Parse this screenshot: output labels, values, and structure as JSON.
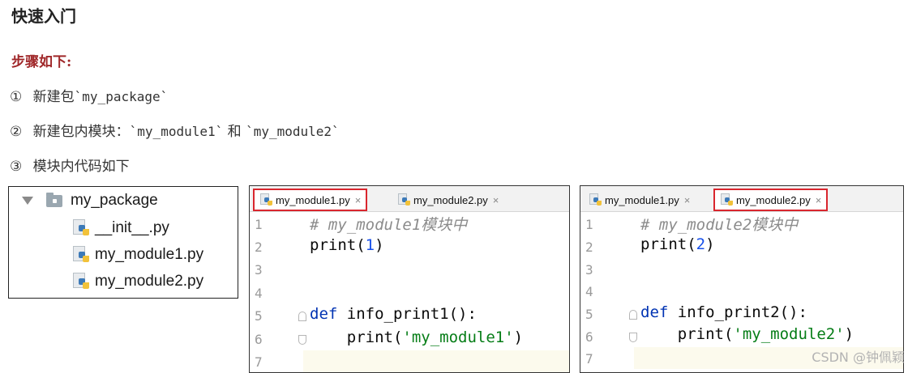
{
  "heading": "快速入门",
  "steps_label": "步骤如下:",
  "steps": [
    {
      "num": "①",
      "text": "新建包",
      "code": "`my_package`",
      "rest": ""
    },
    {
      "num": "②",
      "text": "新建包内模块：",
      "code": "`my_module1`",
      "mid": " 和 ",
      "code2": "`my_module2`"
    },
    {
      "num": "③",
      "text": "模块内代码如下"
    }
  ],
  "tree": {
    "folder": "my_package",
    "files": [
      "__init__.py",
      "my_module1.py",
      "my_module2.py"
    ]
  },
  "editor1": {
    "tabs": [
      "my_module1.py",
      "my_module2.py"
    ],
    "active_tab": "my_module1.py",
    "line_numbers": [
      "1",
      "2",
      "3",
      "4",
      "5",
      "6",
      "7"
    ],
    "lines": {
      "l1": "# my_module1模块中",
      "l2_fn": "print(",
      "l2_num": "1",
      "l2_end": ")",
      "l5_kw": "def",
      "l5_rest": " info_print1():",
      "l6_fn": "    print(",
      "l6_str": "'my_module1'",
      "l6_end": ")"
    }
  },
  "editor2": {
    "tabs": [
      "my_module1.py",
      "my_module2.py"
    ],
    "active_tab": "my_module2.py",
    "line_numbers": [
      "1",
      "2",
      "3",
      "4",
      "5",
      "6",
      "7"
    ],
    "lines": {
      "l1": "# my_module2模块中",
      "l2_fn": "print(",
      "l2_num": "2",
      "l2_end": ")",
      "l5_kw": "def",
      "l5_rest": " info_print2():",
      "l6_fn": "    print(",
      "l6_str": "'my_module2'",
      "l6_end": ")"
    }
  },
  "close_glyph": "×",
  "watermark": "CSDN @钟佩颖",
  "colors": {
    "accent_red": "#d9262e",
    "heading_red": "#a0282a",
    "keyword": "#0033b3",
    "string": "#067d17",
    "number": "#1750eb"
  }
}
